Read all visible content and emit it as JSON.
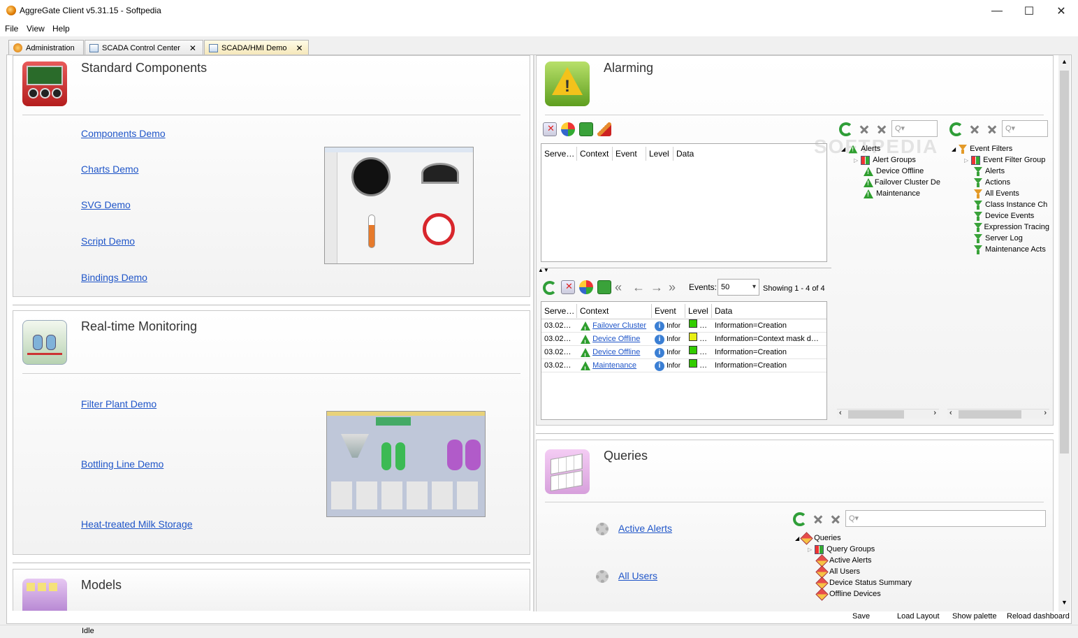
{
  "window": {
    "title": "AggreGate Client v5.31.15 - Softpedia",
    "buttons": {
      "minimize": "—",
      "maximize": "☐",
      "close": "✕"
    }
  },
  "menu": [
    "File",
    "View",
    "Help"
  ],
  "tabs": [
    {
      "label": "Administration",
      "closable": false
    },
    {
      "label": "SCADA Control Center",
      "closable": true
    },
    {
      "label": "SCADA/HMI Demo",
      "closable": true,
      "active": true
    }
  ],
  "left": {
    "standard": {
      "title": "Standard Components",
      "links": [
        "Components Demo",
        "Charts Demo",
        "SVG Demo",
        "Script Demo",
        "Bindings Demo"
      ]
    },
    "realtime": {
      "title": "Real-time Monitoring",
      "links": [
        "Filter Plant Demo",
        "Bottling Line Demo",
        "Heat-treated Milk Storage"
      ]
    },
    "models": {
      "title": "Models"
    }
  },
  "alarming": {
    "title": "Alarming",
    "top_grid_columns": [
      "Serve…",
      "Context",
      "Event",
      "Level",
      "Data"
    ],
    "events_label": "Events:",
    "events_value": "50",
    "showing": "Showing 1 - 4 of 4",
    "bottom_grid_columns": [
      "Serve…",
      "Context",
      "Event",
      "Level",
      "Data"
    ],
    "rows": [
      {
        "server": "03.02…",
        "context": "Failover Cluster",
        "event": "info",
        "level": "green",
        "dots": "…",
        "data": "Information=Creation"
      },
      {
        "server": "03.02…",
        "context": "Device Offline",
        "event": "info",
        "level": "yellow",
        "dots": "…",
        "data": "Information=Context mask d…"
      },
      {
        "server": "03.02…",
        "context": "Device Offline",
        "event": "info",
        "level": "green",
        "dots": "…",
        "data": "Information=Creation"
      },
      {
        "server": "03.02…",
        "context": "Maintenance",
        "event": "info",
        "level": "green",
        "dots": "…",
        "data": "Information=Creation"
      }
    ],
    "event_cell_text": "Infor",
    "alerts_tree": {
      "root": "Alerts",
      "group": "Alert Groups",
      "items": [
        "Device Offline",
        "Failover Cluster De",
        "Maintenance"
      ]
    },
    "filters_tree": {
      "root": "Event Filters",
      "group": "Event Filter Group",
      "items": [
        "Alerts",
        "Actions",
        "All Events",
        "Class Instance Ch",
        "Device Events",
        "Expression Tracing",
        "Server Log",
        "Maintenance Acts"
      ]
    },
    "search_placeholder": "Q▾",
    "watermark": "SOFTPEDIA"
  },
  "queries": {
    "title": "Queries",
    "links": [
      "Active Alerts",
      "All Users"
    ],
    "tree": {
      "root": "Queries",
      "group": "Query Groups",
      "items": [
        "Active Alerts",
        "All Users",
        "Device Status Summary",
        "Offline Devices"
      ]
    }
  },
  "bottom_buttons": [
    "Save",
    "Load Layout",
    "Show palette",
    "Reload dashboard"
  ],
  "status": "Idle"
}
